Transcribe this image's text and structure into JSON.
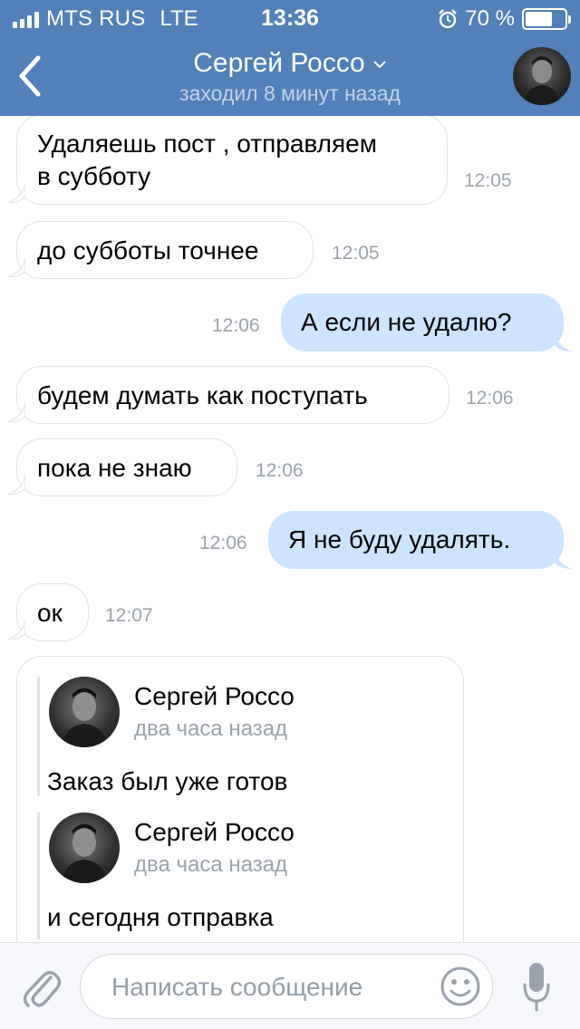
{
  "status_bar": {
    "carrier": "MTS RUS",
    "network": "LTE",
    "time": "13:36",
    "battery": "70 %",
    "battery_level": 0.7
  },
  "header": {
    "back_icon": "chevron-left-icon",
    "contact_name": "Сергей Россо",
    "last_seen": "заходил 8 минут назад"
  },
  "messages": [
    {
      "direction": "in",
      "lines": [
        "Удаляешь пост , отправляем",
        "в субботу"
      ],
      "time": "12:05"
    },
    {
      "direction": "in",
      "text": "до субботы точнее",
      "time": "12:05"
    },
    {
      "direction": "out",
      "text": "А если не удалю?",
      "time": "12:06"
    },
    {
      "direction": "in",
      "text": "будем думать как поступать",
      "time": "12:06"
    },
    {
      "direction": "in",
      "text": "пока не знаю",
      "time": "12:06"
    },
    {
      "direction": "out",
      "text": "Я не буду удалять.",
      "time": "12:06"
    },
    {
      "direction": "in",
      "text": "ок",
      "time": "12:07"
    }
  ],
  "forwarded": [
    {
      "name": "Сергей Россо",
      "time": "два часа назад",
      "text": "Заказ был уже готов"
    },
    {
      "name": "Сергей Россо",
      "time": "два часа назад",
      "text": "и сегодня отправка"
    }
  ],
  "composer": {
    "placeholder": "Написать сообщение"
  },
  "colors": {
    "header": "#5181b8",
    "outgoing_bubble": "#cce4ff",
    "incoming_bubble": "#ffffff",
    "timestamp": "#9aa3ad"
  }
}
